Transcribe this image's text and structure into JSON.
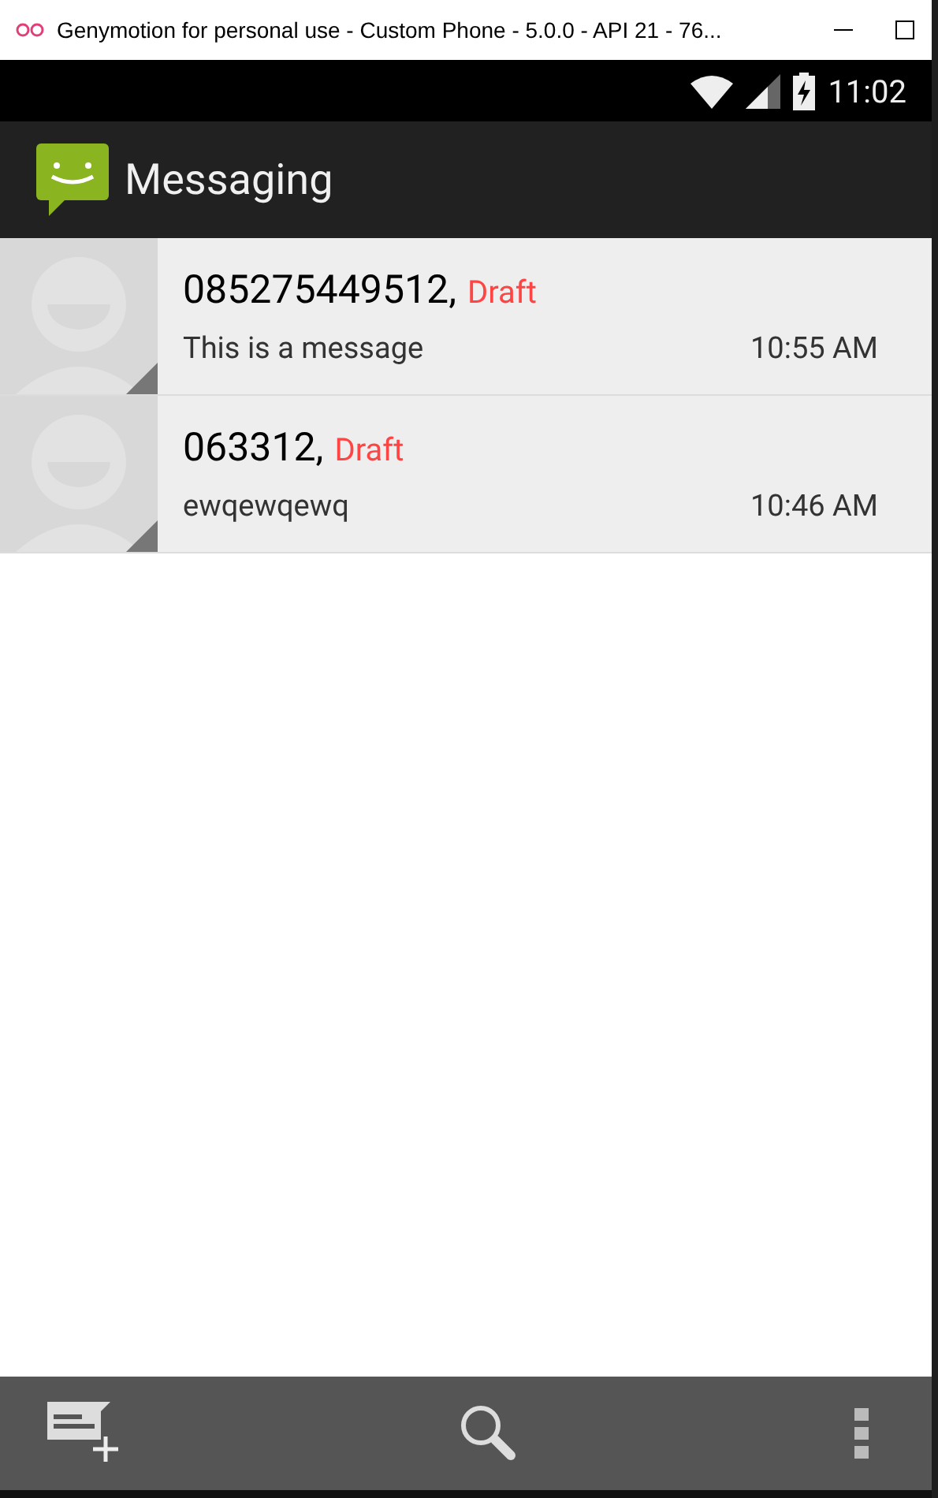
{
  "window": {
    "title": "Genymotion for personal use - Custom Phone - 5.0.0 - API 21 - 76..."
  },
  "status_bar": {
    "time": "11:02"
  },
  "app_bar": {
    "title": "Messaging"
  },
  "conversations": [
    {
      "sender": "085275449512,",
      "status": "Draft",
      "snippet": "This is a message",
      "time": "10:55 AM"
    },
    {
      "sender": "063312,",
      "status": "Draft",
      "snippet": "ewqewqewq",
      "time": "10:46 AM"
    }
  ]
}
